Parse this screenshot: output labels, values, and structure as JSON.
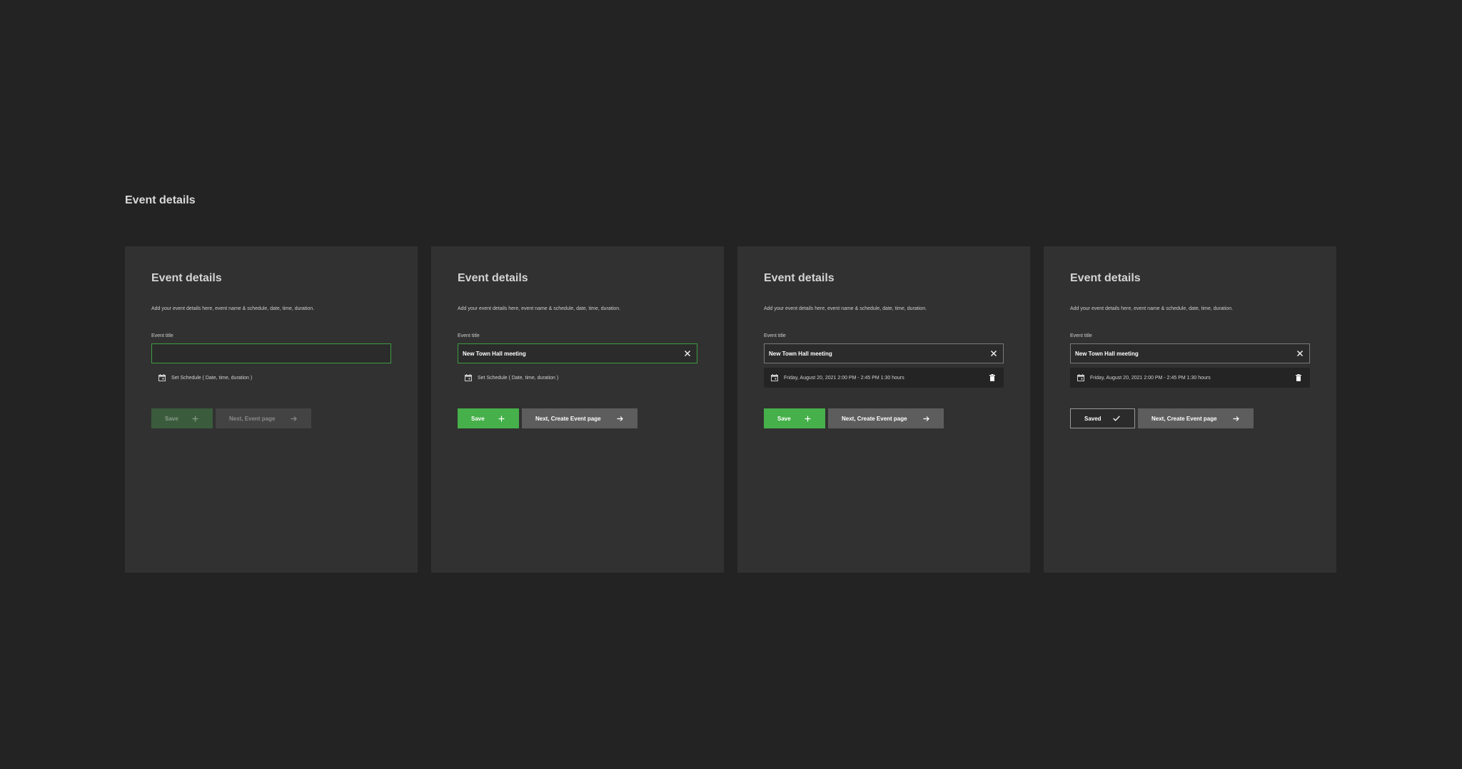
{
  "page": {
    "heading": "Event details"
  },
  "colors": {
    "accent_green": "#46b04a",
    "panel_bg": "#313131",
    "page_bg": "#232323"
  },
  "panels": [
    {
      "title": "Event details",
      "description": "Add your event details here, event name & schedule, date, time, duration.",
      "field_label": "Event title",
      "title_value": "",
      "schedule_text": "Set Schedule ( Date, time, duration )",
      "save_label": "Save",
      "next_label": "Next, Event page"
    },
    {
      "title": "Event details",
      "description": "Add your event details here, event name & schedule, date, time, duration.",
      "field_label": "Event title",
      "title_value": "New Town Hall meeting",
      "schedule_text": "Set Schedule ( Date, time, duration )",
      "save_label": "Save",
      "next_label": "Next, Create Event page"
    },
    {
      "title": "Event details",
      "description": "Add your event details here, event name & schedule, date, time, duration.",
      "field_label": "Event title",
      "title_value": "New Town Hall meeting",
      "schedule_text": "Friday, August 20, 2021 2:00 PM - 2:45 PM 1:30 hours",
      "save_label": "Save",
      "next_label": "Next, Create Event page"
    },
    {
      "title": "Event details",
      "description": "Add your event details here, event name & schedule, date, time, duration.",
      "field_label": "Event title",
      "title_value": "New Town Hall meeting",
      "schedule_text": "Friday, August 20, 2021 2:00 PM - 2:45 PM 1:30 hours",
      "save_label": "Saved",
      "next_label": "Next, Create Event page"
    }
  ],
  "icons": {
    "calendar": "calendar-icon",
    "clear": "close-icon",
    "delete": "trash-icon",
    "add": "plus-icon",
    "next": "arrow-right-icon",
    "saved": "check-icon"
  }
}
